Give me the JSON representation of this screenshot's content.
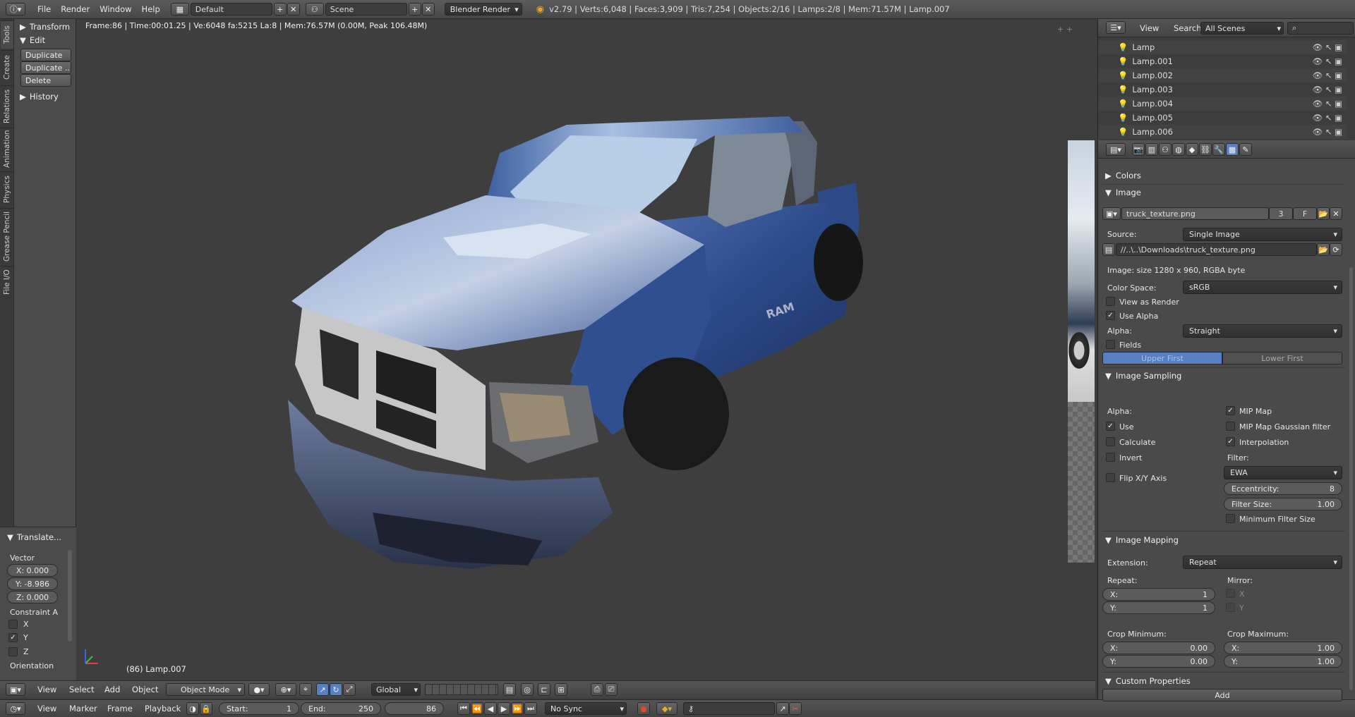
{
  "topbar": {
    "menu": [
      "File",
      "Render",
      "Window",
      "Help"
    ],
    "layout": "Default",
    "scene": "Scene",
    "engine": "Blender Render",
    "stats": "v2.79 | Verts:6,048 | Faces:3,909 | Tris:7,254 | Objects:2/16 | Lamps:2/8 | Mem:71.57M | Lamp.007"
  },
  "tool_tabs": [
    "Tools",
    "Create",
    "Relations",
    "Animation",
    "Physics",
    "Grease Pencil",
    "File I/O"
  ],
  "tool_panel": {
    "transform": "Transform",
    "edit": "Edit",
    "buttons": [
      "Duplicate",
      "Duplicate ...",
      "Delete"
    ],
    "history": "History",
    "translate": "Translate...",
    "vector_label": "Vector",
    "x": "X: 0.000",
    "y": "Y: -8.986",
    "z": "Z: 0.000",
    "constraint": "Constraint A",
    "cx": "X",
    "cy": "Y",
    "cz": "Z",
    "orientation": "Orientation"
  },
  "viewport": {
    "info": "Frame:86 | Time:00:01.25 | Ve:6048 fa:5215 La:8 | Mem:76.57M (0.00M, Peak 106.48M)",
    "object": "(86) Lamp.007"
  },
  "viewport_header": {
    "menu": [
      "View",
      "Select",
      "Add",
      "Object"
    ],
    "mode": "Object Mode",
    "orientation": "Global"
  },
  "timeline": {
    "menu": [
      "View",
      "Marker",
      "Frame",
      "Playback"
    ],
    "start_label": "Start:",
    "start": "1",
    "end_label": "End:",
    "end": "250",
    "current": "86",
    "sync": "No Sync"
  },
  "outliner": {
    "menu": [
      "View",
      "Search"
    ],
    "scenes": "All Scenes",
    "rows": [
      "Lamp",
      "Lamp.001",
      "Lamp.002",
      "Lamp.003",
      "Lamp.004",
      "Lamp.005",
      "Lamp.006"
    ]
  },
  "properties": {
    "colors": "Colors",
    "image": "Image",
    "image_name": "truck_texture.png",
    "users": "3",
    "fake": "F",
    "source_label": "Source:",
    "source": "Single Image",
    "path": "//..\\..\\Downloads\\truck_texture.png",
    "image_info": "Image: size 1280 x 960, RGBA byte",
    "color_space_label": "Color Space:",
    "color_space": "sRGB",
    "view_as_render": "View as Render",
    "use_alpha": "Use Alpha",
    "alpha_label": "Alpha:",
    "alpha": "Straight",
    "fields": "Fields",
    "upper_first": "Upper First",
    "lower_first": "Lower First",
    "sampling": "Image Sampling",
    "s_alpha": "Alpha:",
    "s_use": "Use",
    "s_calculate": "Calculate",
    "s_invert": "Invert",
    "s_flip": "Flip X/Y Axis",
    "mip_map": "MIP Map",
    "mip_gauss": "MIP Map Gaussian filter",
    "interpolation": "Interpolation",
    "filter_label": "Filter:",
    "filter": "EWA",
    "eccentricity_label": "Eccentricity:",
    "eccentricity": "8",
    "filter_size_label": "Filter Size:",
    "filter_size": "1.00",
    "min_filter": "Minimum Filter Size",
    "mapping": "Image Mapping",
    "extension_label": "Extension:",
    "extension": "Repeat",
    "repeat_label": "Repeat:",
    "mirror_label": "Mirror:",
    "rx_label": "X:",
    "rx": "1",
    "ry_label": "Y:",
    "ry": "1",
    "mx": "X",
    "my": "Y",
    "crop_min": "Crop Minimum:",
    "crop_max": "Crop Maximum:",
    "cminx": "0.00",
    "cminy": "0.00",
    "cmaxx": "1.00",
    "cmaxy": "1.00",
    "custom": "Custom Properties",
    "add": "Add"
  }
}
